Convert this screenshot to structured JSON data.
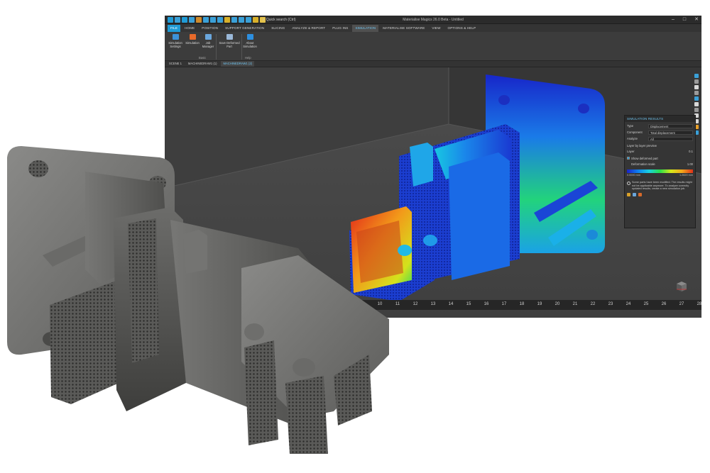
{
  "window": {
    "title": "Materialise Magics 26.0 Beta - Untitled",
    "quick_search": "Quick search (Ctrl)",
    "controls": [
      "–",
      "□",
      "✕"
    ],
    "quick_access_colors": [
      "#1f9bd6",
      "#3aa0d8",
      "#1f9bd6",
      "#3aa0d8",
      "#d08a2a",
      "#3aa0d8",
      "#3aa0d8",
      "#3aa0d8",
      "#d8b02a",
      "#3aa0d8",
      "#3aa0d8",
      "#3aa0d8",
      "#d8b02a",
      "#e4c24a"
    ]
  },
  "menu": {
    "tabs": [
      "FILE",
      "HOME",
      "POSITION",
      "SUPPORT GENERATION",
      "SLICING",
      "ANALYZE & REPORT",
      "PLUG INS",
      "SIMULATION",
      "MATERIALISE SOFTWARE",
      "VIEW",
      "OPTIONS & HELP"
    ],
    "active": "SIMULATION"
  },
  "ribbon": {
    "buttons": [
      {
        "label": "Simulation\nSettings",
        "icon": "gear-icon",
        "color": "#3c92d8"
      },
      {
        "label": "Simulation",
        "icon": "simulation-icon",
        "color": "#e86a2a"
      },
      {
        "label": "Job\nManager",
        "icon": "job-manager-icon",
        "color": "#6aa6dc"
      },
      {
        "label": "Save Deformed\nPart",
        "icon": "save-icon",
        "color": "#9ab8d8"
      },
      {
        "label": "About\nSimulation",
        "icon": "info-icon",
        "color": "#2d8fe0"
      }
    ],
    "groups": [
      "Basic",
      "Help"
    ]
  },
  "scene_tabs": [
    "SCENE 1",
    "MACHINEDRAW1 (1)",
    "MACHINEDRAW1 (2)"
  ],
  "ruler": {
    "ticks": [
      "9",
      "10",
      "11",
      "12",
      "13",
      "14",
      "15",
      "16",
      "17",
      "18",
      "19",
      "20",
      "21",
      "22",
      "23",
      "24",
      "25",
      "26",
      "27",
      "28",
      "29"
    ],
    "unit": "cm"
  },
  "panel": {
    "title": "SIMULATION RESULTS",
    "rows": [
      {
        "label": "Type",
        "value": "Displacement"
      },
      {
        "label": "Component",
        "value": "Total displacement"
      },
      {
        "label": "Analyze",
        "value": "All"
      }
    ],
    "layer_preview": "Layer by layer preview",
    "layer_label": "Layer",
    "layer_value": "0.1",
    "show_deformed": "Show deformed part",
    "deformation_scale_label": "Deformation scale",
    "deformation_scale_value": "1.00",
    "legend_min": "0.0000 mm",
    "legend_max": "1.2820 mm",
    "warning": "Some parts have been modified. The results might not be applicable anymore. To analyze correctly updated results, create a new simulation job."
  },
  "right_toolbar_colors": [
    "#3aa0d8",
    "#9a9a9a",
    "#d8d8d8",
    "#9a9a9a",
    "#3aa0d8",
    "#d8d8d8",
    "#9a9a9a",
    "#d8d8d8",
    "#d8d8d8",
    "#e8a02a",
    "#3aa0d8"
  ],
  "colors": {
    "accent": "#1f9bd6",
    "viewport_bg": "#3a3a3a"
  }
}
